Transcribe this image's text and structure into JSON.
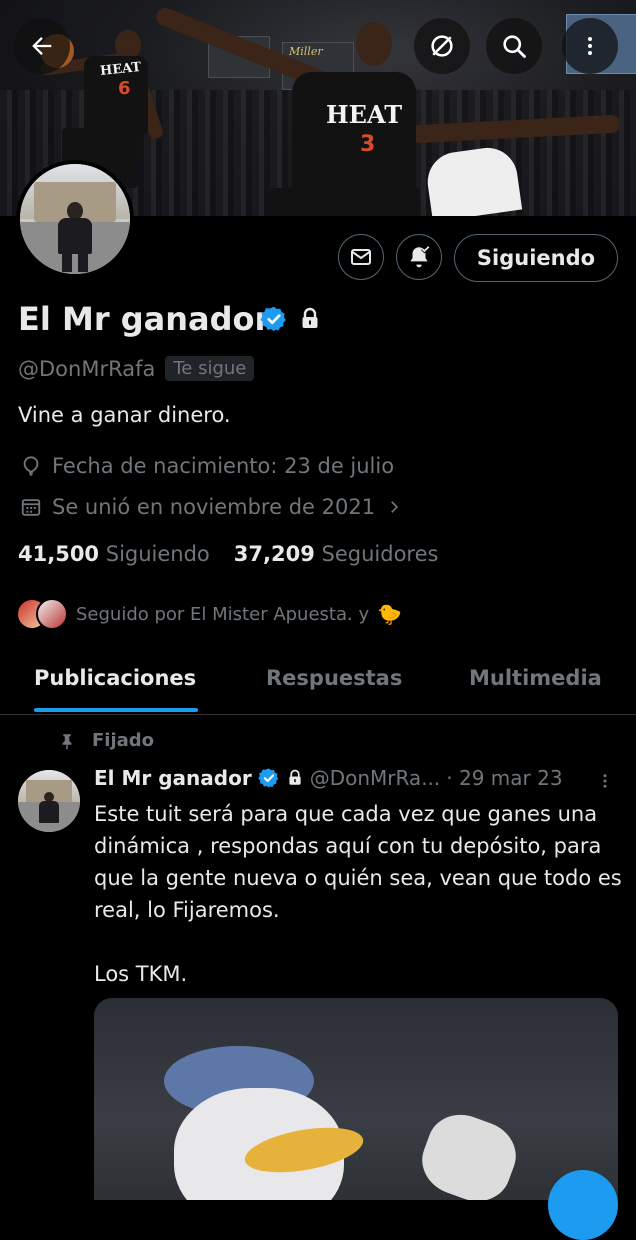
{
  "banner": {
    "back_icon": "arrow-left-icon",
    "grok_icon": "slash-circle-icon",
    "search_icon": "search-icon",
    "more_icon": "more-vertical-icon",
    "jersey_left_text": "HEAT",
    "jersey_left_number": "6",
    "jersey_right_text": "HEAT",
    "jersey_right_number": "3",
    "ad_text": "Miller"
  },
  "profile": {
    "display_name": "El Mr ganador",
    "verified": true,
    "protected": true,
    "handle": "@DonMrRafa",
    "follows_you": "Te sigue",
    "bio": "Vine a ganar dinero.",
    "birthday": "Fecha de nacimiento: 23 de julio",
    "joined": "Se unió en noviembre de 2021",
    "following_count": "41,500",
    "following_label": "Siguiendo",
    "followers_count": "37,209",
    "followers_label": "Seguidores",
    "followed_by": "Seguido por El Mister Apuesta. y",
    "followed_by_emoji": "🐤"
  },
  "actions": {
    "message_icon": "envelope-icon",
    "notify_icon": "bell-check-icon",
    "follow_label": "Siguiendo"
  },
  "tabs": [
    {
      "label": "Publicaciones",
      "active": true
    },
    {
      "label": "Respuestas",
      "active": false
    },
    {
      "label": "Multimedia",
      "active": false
    }
  ],
  "pinned_tweet": {
    "pinned_label": "Fijado",
    "name": "El Mr ganador",
    "handle": "@DonMrRa...",
    "date": "· 29 mar 23",
    "text": "Este tuit será para que cada vez que ganes una dinámica , respondas aquí con tu depósito, para que la gente nueva o quién sea, vean que todo es real, lo Fijaremos.\n\nLos TKM."
  },
  "colors": {
    "accent": "#1d9bf0",
    "muted": "#71767b",
    "text": "#e7e9ea",
    "border": "#536471"
  }
}
